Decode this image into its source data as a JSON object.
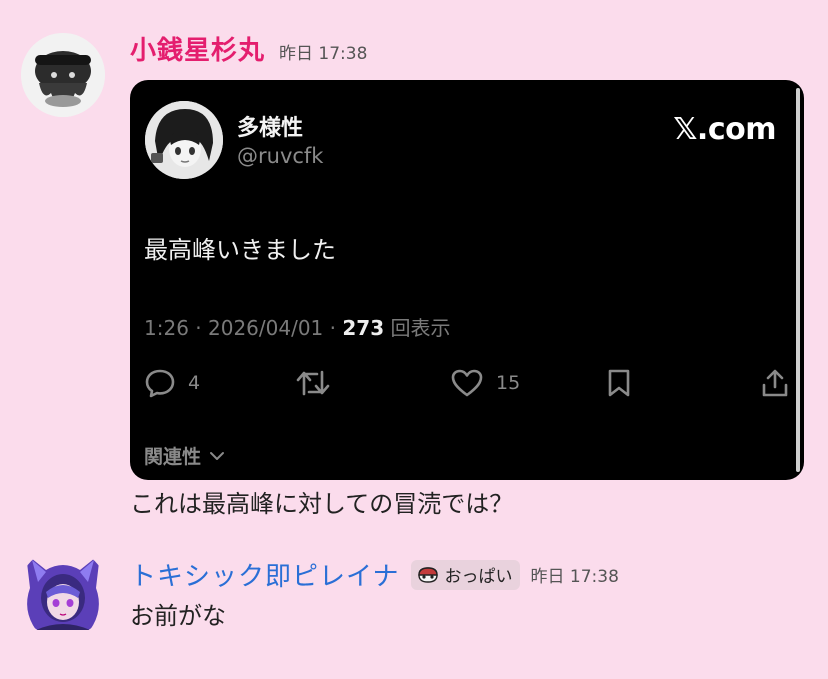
{
  "messages": [
    {
      "author": "小銭星杉丸",
      "timestamp": "昨日 17:38",
      "author_color": "#e41e6e",
      "avatar_icon": "avatar-octopus-plush",
      "embed": {
        "source_logo": "𝕏.com",
        "author_name": "多様性",
        "author_handle": "@ruvcfk",
        "text": "最高峰いきました",
        "time": "1:26",
        "date": "2026/04/01",
        "views": "273",
        "views_label": "回表示",
        "reply_count": "4",
        "like_count": "15",
        "related_label": "関連性",
        "background": "#000000"
      },
      "text": "これは最高峰に対しての冒涜では？"
    },
    {
      "author": "トキシック即ピレイナ",
      "role_badge": "おっぱい",
      "timestamp": "昨日 17:38",
      "author_color": "#2a6fd6",
      "avatar_icon": "avatar-purple-hood-character",
      "text": "お前がな"
    }
  ],
  "colors": {
    "background": "#fbdcec",
    "badge_background": "#e9d2dd"
  }
}
